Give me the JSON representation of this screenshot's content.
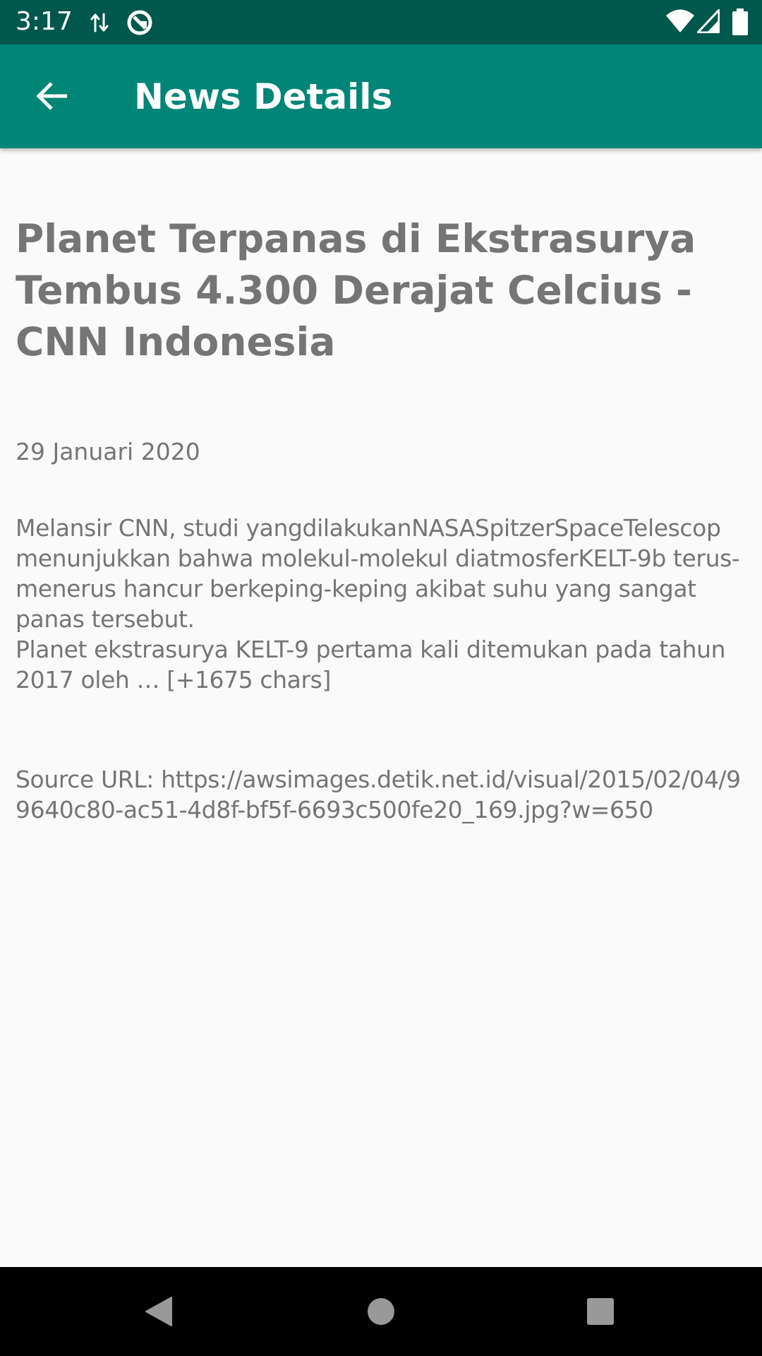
{
  "status_bar": {
    "time": "3:17",
    "icons": [
      "data-transfer-icon",
      "sync-icon",
      "wifi-icon",
      "signal-icon",
      "battery-icon"
    ]
  },
  "app_bar": {
    "title": "News Details",
    "back_icon": "arrow-back-icon",
    "color": "#008577"
  },
  "article": {
    "title": "Planet Terpanas di Ekstrasurya Tembus 4.300 Derajat Celcius - CNN Indonesia",
    "date": "29 Januari 2020",
    "body": "Melansir CNN, studi yangdilakukanNASASpitzerSpaceTelescop menunjukkan bahwa molekul-molekul diatmosferKELT-9b terus-menerus hancur berkeping-keping akibat suhu yang sangat panas tersebut.\nPlanet ekstrasurya KELT-9 pertama kali ditemukan pada tahun 2017 oleh … [+1675 chars]",
    "source": "Source URL: https://awsimages.detik.net.id/visual/2015/02/04/99640c80-ac51-4d8f-bf5f-6693c500fe20_169.jpg?w=650"
  },
  "nav_bar": {
    "icons": [
      "back-triangle-icon",
      "home-circle-icon",
      "recents-square-icon"
    ]
  },
  "colors": {
    "status_bar": "#00574b",
    "app_bar": "#008577",
    "text": "#757575",
    "background": "#fafafa"
  }
}
